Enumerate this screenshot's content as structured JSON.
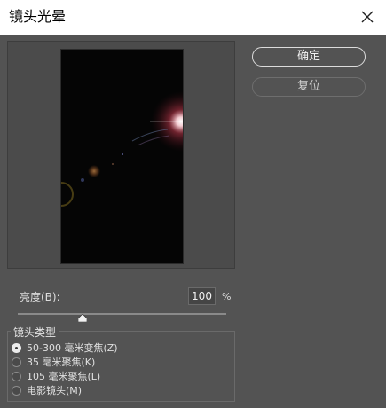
{
  "dialog": {
    "title": "镜头光晕",
    "close_icon": "close-icon"
  },
  "buttons": {
    "ok_label": "确定",
    "reset_label": "复位"
  },
  "brightness": {
    "label": "亮度(B):",
    "value": "100",
    "unit": "%",
    "slider_fraction": 0.31
  },
  "lens_type": {
    "legend": "镜头类型",
    "options": [
      {
        "label": "50-300 毫米变焦(Z)",
        "checked": true
      },
      {
        "label": "35 毫米聚焦(K)",
        "checked": false
      },
      {
        "label": "105 毫米聚焦(L)",
        "checked": false
      },
      {
        "label": "电影镜头(M)",
        "checked": false
      }
    ]
  }
}
